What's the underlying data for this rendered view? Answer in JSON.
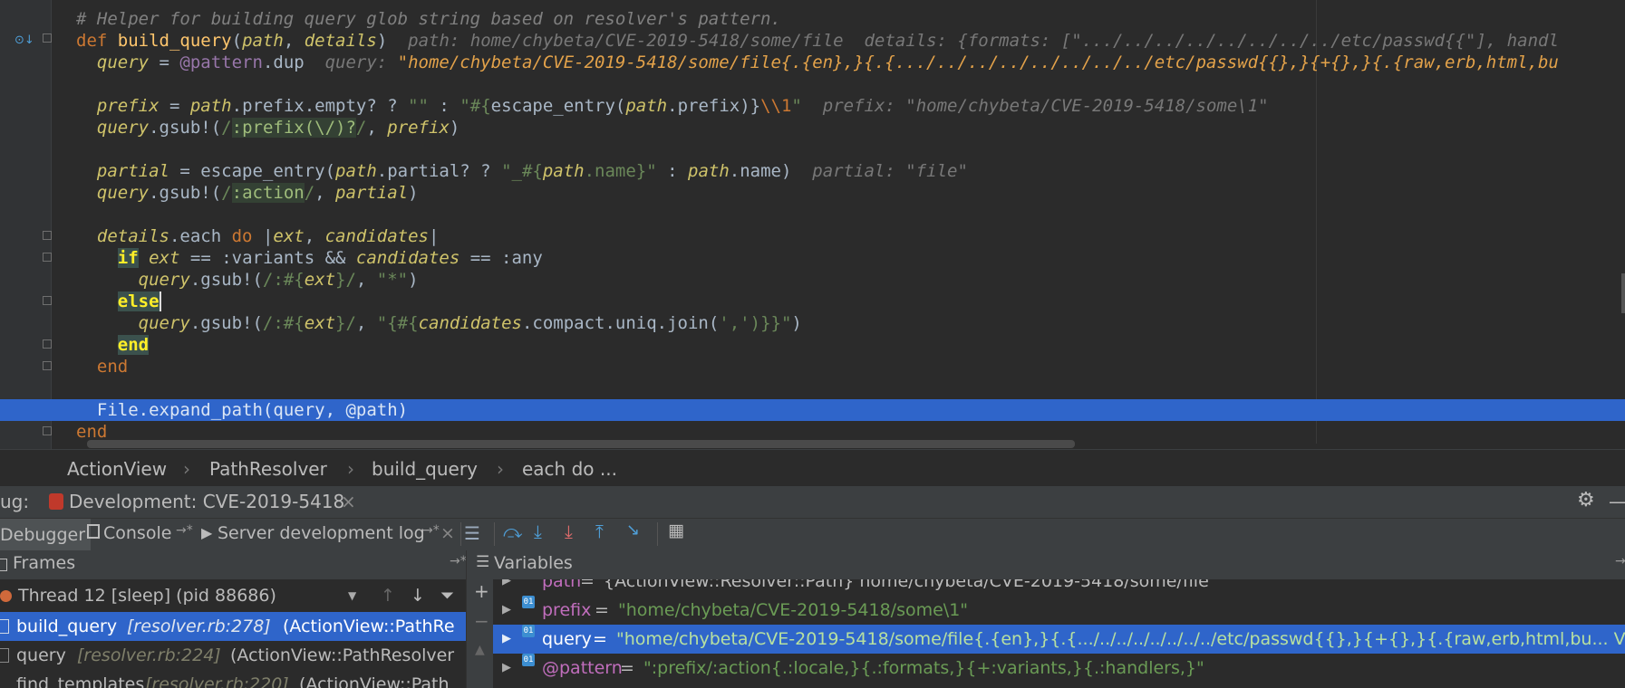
{
  "editor": {
    "comment": "# Helper for building query glob string based on resolver's pattern.",
    "l2": {
      "kw": "def",
      "fn": "build_query",
      "open": "(",
      "p1": "path",
      "comma": ", ",
      "p2": "details",
      "close": ")",
      "inlay": "path: home/chybeta/CVE-2019-5418/some/file  details: {formats: [\".../../../../../../../../etc/passwd{{\"], handl"
    },
    "l3": {
      "var": "query",
      "eq": " = ",
      "ivar": "@pattern",
      "dup": ".dup",
      "inlay_label": "query: ",
      "inlay_val": "\"home/chybeta/CVE-2019-5418/some/file{.{en},}{.{.../../../../../../../../etc/passwd{{},}{+{},}{.{raw,erb,html,bu"
    },
    "l5": {
      "var": "prefix",
      "eq": " = ",
      "p": "path",
      "m1": ".prefix.empty? ? ",
      "s1": "\"\"",
      "m2": " : ",
      "s2": "\"#{",
      "call": "escape_entry(",
      "p2": "path",
      "m3": ".prefix)}",
      "esc": "\\\\1",
      "s3": "\"",
      "inlay": "prefix: \"home/chybeta/CVE-2019-5418/some\\1\""
    },
    "l6": {
      "var": "query",
      "m1": ".gsub!(",
      "s1": "/",
      "sym": ":prefix(\\/)?",
      "s2": "/",
      ",": ", ",
      "v2": "prefix",
      "close": ")"
    },
    "l8": {
      "var": "partial",
      "eq": " = ",
      "call": "escape_entry(",
      "p": "path",
      "m1": ".partial? ? ",
      "s1": "\"_#{",
      "p2": "path",
      "m2": ".name}\"",
      "m3": " : ",
      "p3": "path",
      "m4": ".name)",
      "inlay": "partial: \"file\""
    },
    "l9": {
      "var": "query",
      "m1": ".gsub!(",
      "s1": "/",
      "sym": ":action",
      "s2": "/",
      ",": ", ",
      "v2": "partial",
      "close": ")"
    },
    "l11": {
      "var": "details",
      "m1": ".each ",
      "kw": "do",
      "bar1": " |",
      "a1": "ext",
      "c": ", ",
      "a2": "candidates",
      "bar2": "|"
    },
    "l12": {
      "kw": "if",
      "sp": " ",
      "a1": "ext",
      "m1": " == :variants && ",
      "a2": "candidates",
      "m2": " == :any"
    },
    "l13": {
      "var": "query",
      "m1": ".gsub!(",
      "s1": "/:#{",
      "a1": "ext",
      "s2": "}/",
      "c": ", ",
      "s3": "\"*\"",
      "close": ")"
    },
    "l14": {
      "kw": "else"
    },
    "l15": {
      "var": "query",
      "m1": ".gsub!(",
      "s1": "/:#{",
      "a1": "ext",
      "s2": "}/",
      "c": ", ",
      "s3": "\"{#{",
      "a2": "candidates",
      "m2": ".compact.uniq.join(",
      "s4": "','",
      "m3": ")}}\"",
      "close": ")"
    },
    "l16": {
      "kw": "end"
    },
    "l17": {
      "kw": "end"
    },
    "l19": {
      "cls": "File",
      "m1": ".expand_path(",
      "v1": "query",
      "c": ", ",
      "ivar": "@path",
      "close": ")"
    },
    "l20": {
      "kw": "end"
    }
  },
  "breadcrumb": [
    "ActionView",
    "PathResolver",
    "build_query",
    "each do ..."
  ],
  "runbar": {
    "prefix": "ug:",
    "config": "Development: CVE-2019-5418",
    "close": "×"
  },
  "tabs": {
    "debugger": "Debugger",
    "console": "Console",
    "console_pin": "→*",
    "server_log": "Server development log",
    "server_pin": "→*",
    "close": "×"
  },
  "frames": {
    "title": "Frames",
    "thread": "Thread 12 [sleep] (pid 88686)",
    "items": [
      {
        "name": "build_query",
        "loc": "[resolver.rb:278]",
        "ctx": "(ActionView::PathRe"
      },
      {
        "name": "query",
        "loc": "[resolver.rb:224]",
        "ctx": "(ActionView::PathResolver"
      },
      {
        "name": "find_templates",
        "loc": "[resolver.rb:220]",
        "ctx": "(ActionView::Path"
      }
    ]
  },
  "variables": {
    "title": "Variables",
    "items": [
      {
        "name": "path",
        "eq": " = ",
        "val": "{ActionView::Resolver::Path} home/chybeta/CVE-2019-5418/some/file"
      },
      {
        "name": "prefix",
        "eq": " = ",
        "val": "\"home/chybeta/CVE-2019-5418/some\\1\""
      },
      {
        "name": "query",
        "eq": " = ",
        "val": "\"home/chybeta/CVE-2019-5418/some/file{.{en},}{.{.../../../../../../../../etc/passwd{{},}{+{},}{.{raw,erb,html,bu... View"
      },
      {
        "name": "@pattern",
        "eq": " = ",
        "val": "\":prefix/:action{.:locale,}{.:formats,}{+:variants,}{.:handlers,}\""
      }
    ]
  },
  "colors": {
    "selection": "#2f65ca",
    "keyword": "#cc7832",
    "string": "#6a8759",
    "ivar": "#9876aa"
  }
}
